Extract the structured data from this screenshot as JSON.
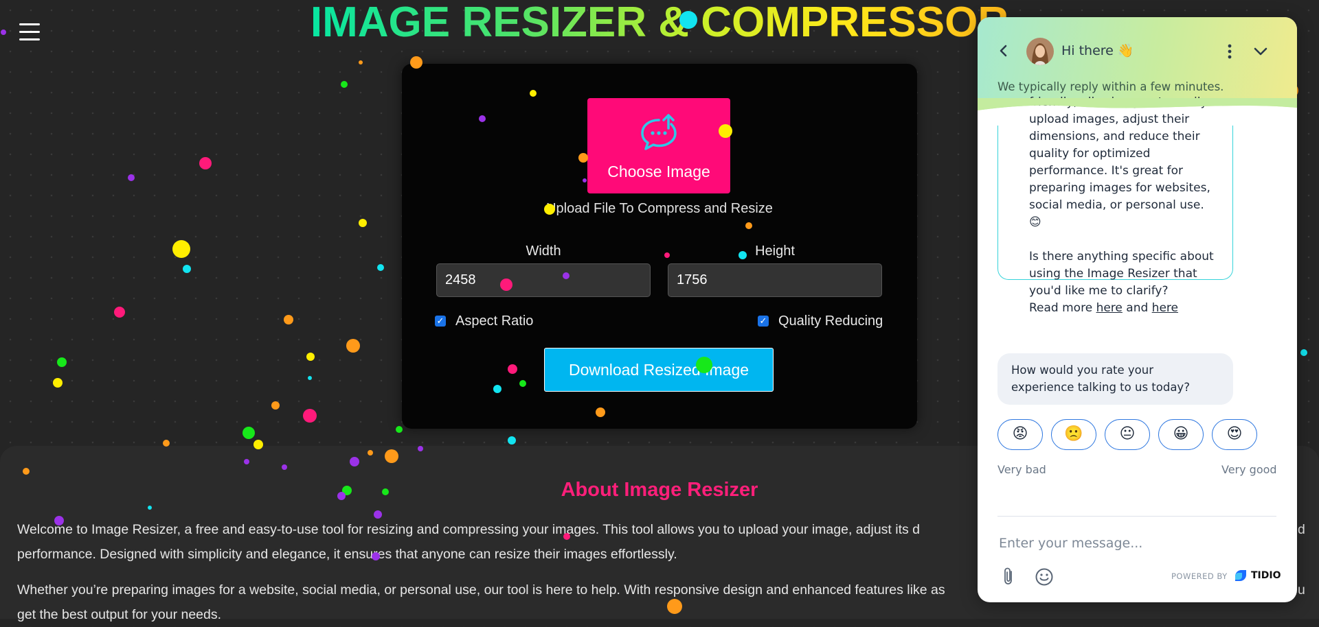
{
  "page": {
    "title": "IMAGE RESIZER & COMPRESSOR",
    "menu_icon": "hamburger-icon"
  },
  "tool": {
    "choose_label": "Choose Image",
    "upload_icon": "upload-chat-icon",
    "upload_hint": "Upload File To Compress and Resize",
    "width_label": "Width",
    "height_label": "Height",
    "width_value": "2458",
    "height_value": "1756",
    "aspect_ratio_label": "Aspect Ratio",
    "aspect_ratio_checked": true,
    "quality_label": "Quality Reducing",
    "quality_checked": true,
    "download_label": "Download Resized Image"
  },
  "about": {
    "title": "About Image Resizer",
    "p1_line1": "Welcome to Image Resizer, a free and easy-to-use tool for resizing and compressing your images. This tool allows you to upload your image, adjust its d",
    "p1_line1_end": "d",
    "p1_line2": "performance. Designed with simplicity and elegance, it ensures that anyone can resize their images effortlessly.",
    "p2_line1": "Whether you’re preparing images for a website, social media, or personal use, our tool is here to help. With responsive design and enhanced features like as",
    "p2_line1_end": "u",
    "p2_line2": "get the best output for your needs."
  },
  "chat": {
    "greeting": "Hi there 👋",
    "reply_note": "We typically reply within a few minutes.",
    "message_lines": [
      "friendly, allowing you to easily",
      "upload images, adjust their",
      "dimensions, and reduce their",
      "quality for optimized",
      "performance. It's great for",
      "preparing images for websites,",
      "social media, or personal use.",
      "😊",
      "",
      "Is there anything specific about",
      "using the Image Resizer that",
      "you'd like me to clarify?"
    ],
    "read_more_prefix": "Read more ",
    "link1": "here",
    "and_text": " and ",
    "link2": "here",
    "rating_question": "How would you rate your experience talking to us today?",
    "ratings": [
      "😡",
      "🙁",
      "😐",
      "😀",
      "😍"
    ],
    "very_bad": "Very bad",
    "very_good": "Very good",
    "input_placeholder": "Enter your message...",
    "powered_by": "POWERED BY",
    "brand": "TIDIO",
    "colors": {
      "border": "#34d3da",
      "rating_border": "#2f78e0"
    }
  },
  "colors": {
    "choose_button": "#ff0a78",
    "download_button": "#00b6f0",
    "about_title": "#ff1f7a"
  }
}
